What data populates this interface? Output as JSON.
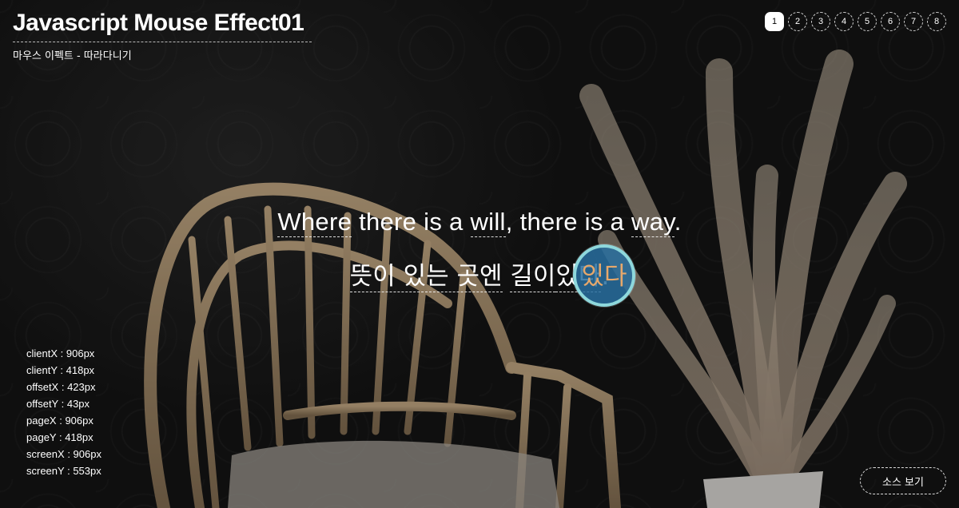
{
  "header": {
    "title": "Javascript Mouse Effect01",
    "subtitle": "마우스 이펙트 - 따라다니기"
  },
  "pager": {
    "active": "1",
    "items": [
      "1",
      "2",
      "3",
      "4",
      "5",
      "6",
      "7",
      "8"
    ]
  },
  "quote": {
    "en": {
      "where": "Where",
      "there_is_a": "there is a",
      "will": "will",
      "there_is_a_2": ", there is a",
      "way": "way",
      "period": "."
    },
    "kr": {
      "p1": "뜻이 있는 곳엔",
      "p2": "길이",
      "p3": "있다",
      "period": "."
    }
  },
  "info": [
    {
      "key": "clientX",
      "value": "906px"
    },
    {
      "key": "clientY",
      "value": "418px"
    },
    {
      "key": "offsetX",
      "value": "423px"
    },
    {
      "key": "offsetY",
      "value": "43px"
    },
    {
      "key": "pageX",
      "value": "906px"
    },
    {
      "key": "pageY",
      "value": "418px"
    },
    {
      "key": "screenX",
      "value": "906px"
    },
    {
      "key": "screenY",
      "value": "553px"
    }
  ],
  "source_button": "소스 보기"
}
